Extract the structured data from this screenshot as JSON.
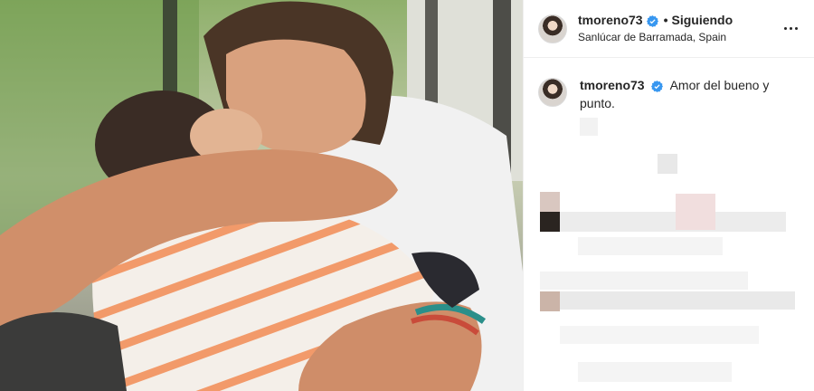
{
  "header": {
    "username": "tmoreno73",
    "follow_separator": "•",
    "follow_status": "Siguiendo",
    "location": "Sanlúcar de Barramada, Spain"
  },
  "caption": {
    "username": "tmoreno73",
    "text": "Amor del bueno y punto."
  },
  "colors": {
    "verified_badge": "#3897f0",
    "text": "#262626",
    "border": "#efefef"
  },
  "icons": {
    "verified": "verified-badge-icon",
    "more": "more-options-icon"
  }
}
